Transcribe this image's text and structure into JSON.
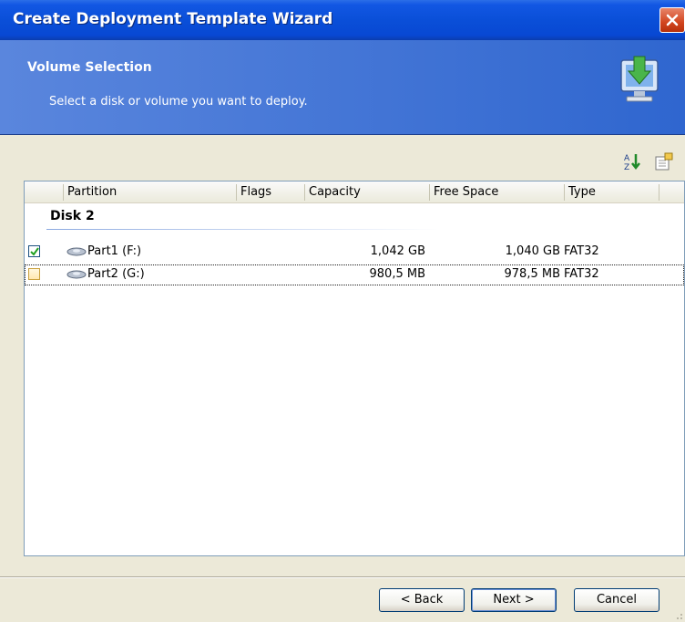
{
  "window": {
    "title": "Create Deployment Template Wizard"
  },
  "header": {
    "title": "Volume Selection",
    "subtitle": "Select a disk or volume you want to deploy."
  },
  "toolbar": {
    "icons": [
      "sort-icon",
      "properties-icon"
    ]
  },
  "list": {
    "columns": [
      "Partition",
      "Flags",
      "Capacity",
      "Free Space",
      "Type"
    ],
    "group": "Disk 2",
    "rows": [
      {
        "checked": true,
        "partition": "Part1 (F:)",
        "flags": "",
        "capacity": "1,042 GB",
        "free_space": "1,040 GB",
        "type": "FAT32"
      },
      {
        "checked": false,
        "partition": "Part2 (G:)",
        "flags": "",
        "capacity": "980,5 MB",
        "free_space": "978,5 MB",
        "type": "FAT32"
      }
    ]
  },
  "buttons": {
    "back": "< Back",
    "next": "Next >",
    "cancel": "Cancel"
  },
  "colors": {
    "titlebar": "#0a4fd8",
    "header": "#3a6fd2",
    "accent": "#1c5180"
  }
}
